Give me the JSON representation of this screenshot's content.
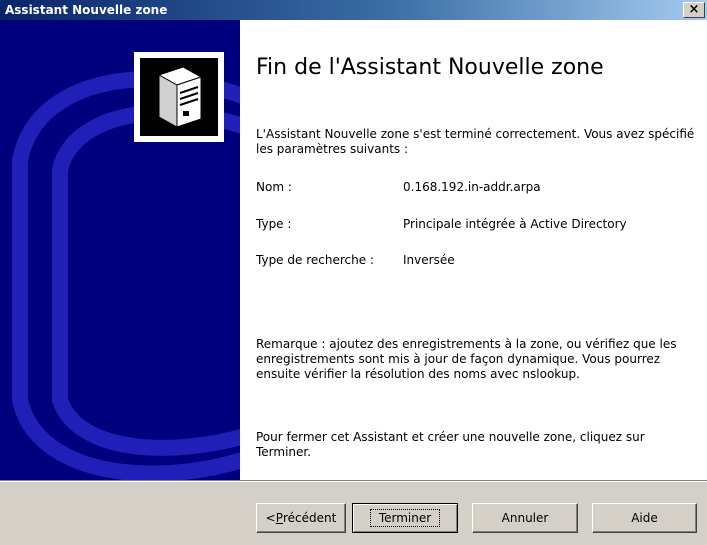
{
  "window": {
    "title": "Assistant Nouvelle zone",
    "close_glyph": "×"
  },
  "main": {
    "heading": "Fin de l'Assistant Nouvelle zone",
    "intro": "L'Assistant Nouvelle zone s'est terminé correctement. Vous avez spécifié les paramètres suivants :",
    "settings": [
      {
        "label": "Nom :",
        "value": "0.168.192.in-addr.arpa"
      },
      {
        "label": "Type :",
        "value": "Principale intégrée à Active Directory"
      },
      {
        "label": "Type de recherche :",
        "value": "Inversée"
      }
    ],
    "note": "Remarque : ajoutez des enregistrements à la zone, ou vérifiez que les enregistrements sont mis à jour de façon dynamique. Vous pourrez ensuite vérifier la résolution des noms avec nslookup.",
    "finish_hint": "Pour fermer cet Assistant et créer une nouvelle zone, cliquez sur Terminer."
  },
  "buttons": {
    "back_prefix": "< ",
    "back_mnemonic": "P",
    "back_rest": "récédent",
    "finish": "Terminer",
    "cancel": "Annuler",
    "help": "Aide"
  },
  "colors": {
    "sidebar_blue": "#00007f",
    "titlebar_start": "#0a246a",
    "titlebar_end": "#a6caf0",
    "face": "#d4d0c8"
  },
  "icons": {
    "sidebar": "server-icon"
  }
}
